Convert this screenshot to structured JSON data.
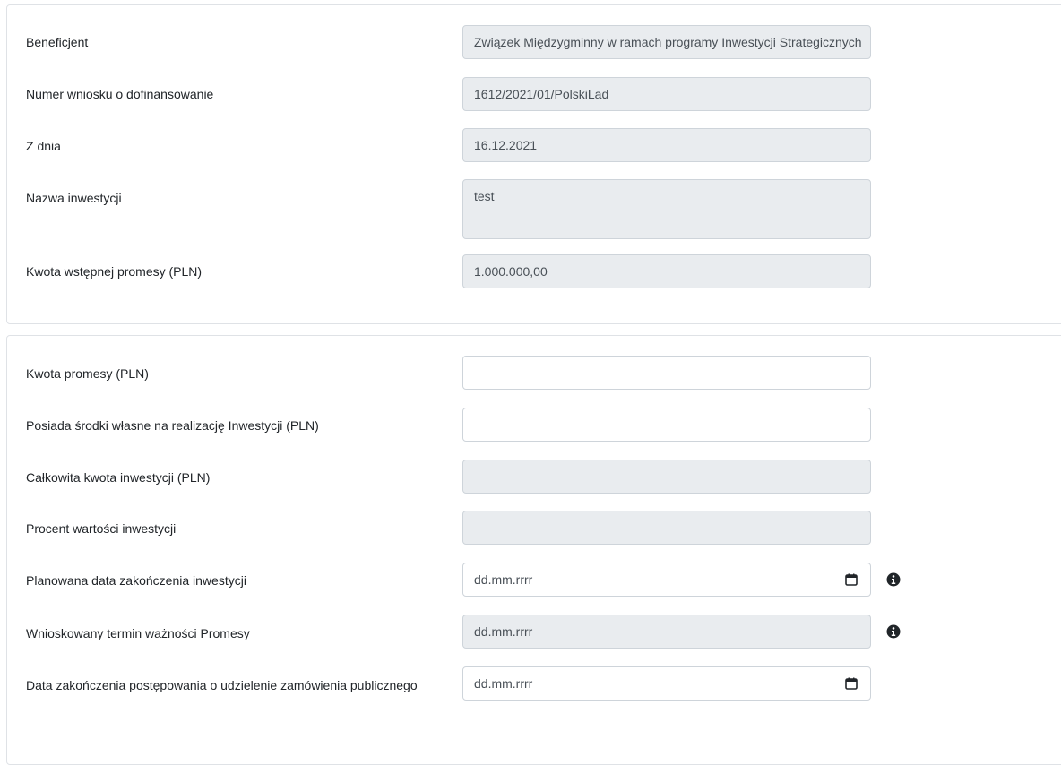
{
  "section1": {
    "beneficiary": {
      "label": "Beneficjent",
      "value": "Związek Międzygminny w ramach programy Inwestycji Strategicznych"
    },
    "application_number": {
      "label": "Numer wniosku o dofinansowanie",
      "value": "1612/2021/01/PolskiLad"
    },
    "date": {
      "label": "Z dnia",
      "value": "16.12.2021"
    },
    "investment_name": {
      "label": "Nazwa inwestycji",
      "value": "test"
    },
    "preliminary_amount": {
      "label": "Kwota wstępnej promesy (PLN)",
      "value": "1.000.000,00"
    }
  },
  "section2": {
    "promise_amount": {
      "label": "Kwota promesy (PLN)",
      "value": ""
    },
    "own_funds": {
      "label": "Posiada środki własne na realizację Inwestycji (PLN)",
      "value": ""
    },
    "total_amount": {
      "label": "Całkowita kwota inwestycji (PLN)",
      "value": ""
    },
    "percent_value": {
      "label": "Procent wartości inwestycji",
      "value": ""
    },
    "planned_end_date": {
      "label": "Planowana data zakończenia inwestycji",
      "placeholder": "dd.mm.rrrr"
    },
    "requested_validity": {
      "label": "Wnioskowany termin ważności Promesy",
      "placeholder": "dd.mm.rrrr"
    },
    "procurement_end_date": {
      "label": "Data zakończenia postępowania o udzielenie zamówienia publicznego",
      "placeholder": "dd.mm.rrrr"
    }
  },
  "icons": {
    "calendar": "calendar-icon",
    "info": "info-icon"
  }
}
